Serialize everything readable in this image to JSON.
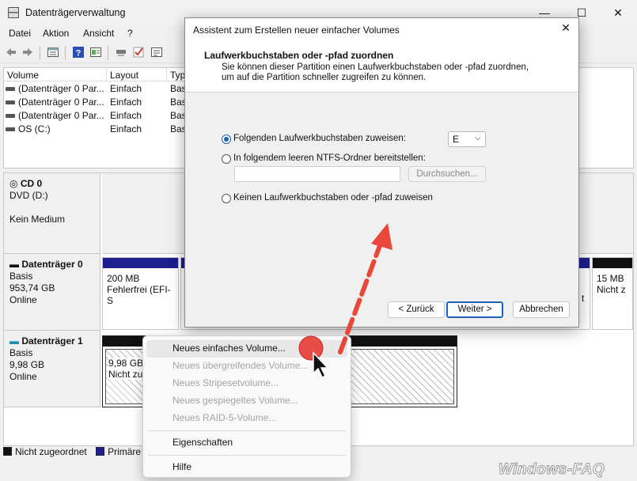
{
  "window": {
    "title": "Datenträgerverwaltung",
    "min": "—",
    "max": "☐",
    "close": "✕"
  },
  "menu": [
    "Datei",
    "Aktion",
    "Ansicht",
    "?"
  ],
  "toolbar_icons": [
    "back-icon",
    "forward-icon",
    "properties-icon",
    "help-icon",
    "view-icon",
    "connect-icon",
    "check-icon",
    "settings-icon"
  ],
  "volumes": {
    "columns": [
      "Volume",
      "Layout",
      "Typ"
    ],
    "rows": [
      {
        "name": "(Datenträger 0 Par...",
        "layout": "Einfach",
        "type": "Basi"
      },
      {
        "name": "(Datenträger 0 Par...",
        "layout": "Einfach",
        "type": "Basi"
      },
      {
        "name": "(Datenträger 0 Par...",
        "layout": "Einfach",
        "type": "Basi"
      },
      {
        "name": "OS (C:)",
        "layout": "Einfach",
        "type": "Basi"
      }
    ]
  },
  "disks": {
    "cd": {
      "name": "CD 0",
      "type": "DVD (D:)",
      "status": "Kein Medium"
    },
    "disk0": {
      "name": "Datenträger 0",
      "type": "Basis",
      "size": "953,74 GB",
      "status": "Online",
      "part1_size": "200 MB",
      "part1_status": "Fehlerfrei (EFI-S",
      "partlast_size": "15 MB",
      "partlast_status": "Nicht z",
      "partmid_tail": "t"
    },
    "disk1": {
      "name": "Datenträger 1",
      "type": "Basis",
      "size": "9,98 GB",
      "status": "Online",
      "part_size": "9,98 GB",
      "part_status": "Nicht zu"
    }
  },
  "legend": {
    "unallocated": "Nicht zugeordnet",
    "primary": "Primäre",
    "unallocated_color": "#111111",
    "primary_color": "#1e1e8c"
  },
  "dialog": {
    "title": "Assistent zum Erstellen neuer einfacher Volumes",
    "heading": "Laufwerkbuchstaben oder -pfad zuordnen",
    "description": "Sie können dieser Partition einen Laufwerkbuchstaben oder -pfad zuordnen, um auf die Partition schneller zugreifen zu können.",
    "option_letter": "Folgenden Laufwerkbuchstaben zuweisen:",
    "selected_letter": "E",
    "option_folder": "In folgendem leeren NTFS-Ordner bereitstellen:",
    "browse": "Durchsuchen...",
    "option_none": "Keinen Laufwerkbuchstaben oder -pfad zuweisen",
    "back": "< Zurück",
    "next": "Weiter >",
    "cancel": "Abbrechen",
    "close": "✕"
  },
  "context_menu": {
    "items": [
      "Neues einfaches Volume...",
      "Neues übergreifendes Volume...",
      "Neues Stripesetvolume...",
      "Neues gespiegeltes Volume...",
      "Neues RAID-5-Volume...",
      "Eigenschaften",
      "Hilfe"
    ]
  },
  "watermark": "Windows-FAQ",
  "colors": {
    "accent": "#1a62b8",
    "arrow": "#e8473a",
    "disk_bar_primary": "#1e1e8c",
    "disk_bar_unallocated": "#111111"
  }
}
